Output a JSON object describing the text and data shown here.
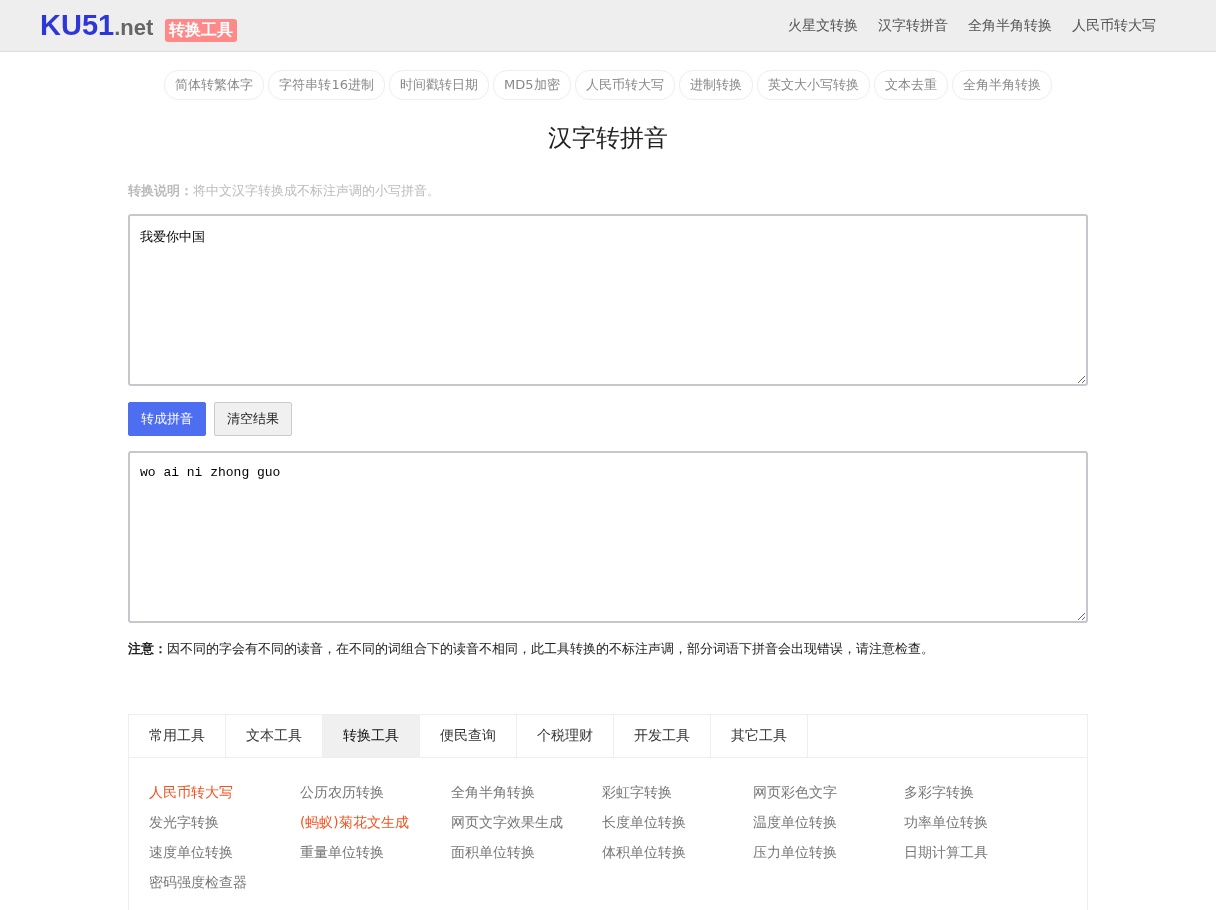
{
  "header": {
    "logo_main": "KU51",
    "logo_suffix": ".net",
    "badge": "转换工具",
    "nav": [
      "火星文转换",
      "汉字转拼音",
      "全角半角转换",
      "人民币转大写"
    ]
  },
  "quick_links": [
    "简体转繁体字",
    "字符串转16进制",
    "时间戳转日期",
    "MD5加密",
    "人民币转大写",
    "进制转换",
    "英文大小写转换",
    "文本去重",
    "全角半角转换"
  ],
  "title": "汉字转拼音",
  "description": "**转换说明：**将中文汉字转换成不标注声调的小写拼音。",
  "input": {
    "value": "我爱你中国"
  },
  "buttons": [
    {
      "label": "转成拼音",
      "kind": "primary"
    },
    {
      "label": "清空结果",
      "kind": "default"
    }
  ],
  "output": {
    "value": "wo ai ni zhong guo"
  },
  "notice": "**注意：**因不同的字会有不同的读音，在不同的词组合下的读音不相同，此工具转换的不标注声调，部分词语下拼音会出现错误，请注意检查。",
  "tool_tabs": [
    {
      "label": "常用工具",
      "selected": false
    },
    {
      "label": "文本工具",
      "selected": false
    },
    {
      "label": "转换工具",
      "selected": true
    },
    {
      "label": "便民查询",
      "selected": false
    },
    {
      "label": "个税理财",
      "selected": false
    },
    {
      "label": "开发工具",
      "selected": false
    },
    {
      "label": "其它工具",
      "selected": false
    }
  ],
  "tool_links": [
    {
      "label": "人民币转大写",
      "hot": true
    },
    {
      "label": "公历农历转换",
      "hot": false
    },
    {
      "label": "全角半角转换",
      "hot": false
    },
    {
      "label": "彩虹字转换",
      "hot": false
    },
    {
      "label": "网页彩色文字",
      "hot": false
    },
    {
      "label": "多彩字转换",
      "hot": false
    },
    {
      "label": "发光字转换",
      "hot": false
    },
    {
      "label": "(蚂蚁)菊花文生成",
      "hot": true
    },
    {
      "label": "网页文字效果生成",
      "hot": false
    },
    {
      "label": "长度单位转换",
      "hot": false
    },
    {
      "label": "温度单位转换",
      "hot": false
    },
    {
      "label": "功率单位转换",
      "hot": false
    },
    {
      "label": "速度单位转换",
      "hot": false
    },
    {
      "label": "重量单位转换",
      "hot": false
    },
    {
      "label": "面积单位转换",
      "hot": false
    },
    {
      "label": "体积单位转换",
      "hot": false
    },
    {
      "label": "压力单位转换",
      "hot": false
    },
    {
      "label": "日期计算工具",
      "hot": false
    },
    {
      "label": "密码强度检查器",
      "hot": false
    }
  ]
}
